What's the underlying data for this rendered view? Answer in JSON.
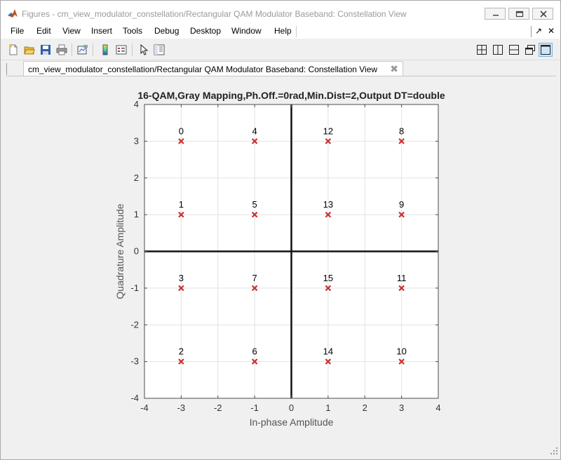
{
  "window": {
    "title": "Figures - cm_view_modulator_constellation/Rectangular QAM Modulator Baseband: Constellation View",
    "controls": [
      "minimize-icon",
      "maximize-icon",
      "close-icon"
    ]
  },
  "menu": {
    "items": [
      "File",
      "Edit",
      "View",
      "Insert",
      "Tools",
      "Debug",
      "Desktop",
      "Window",
      "Help"
    ],
    "right_arrow": "↗",
    "right_close": "✕"
  },
  "toolbar": {
    "left_icons": [
      "new-figure-icon",
      "open-file-icon",
      "save-icon",
      "print-icon",
      "link-plot-icon",
      "insert-colorbar-icon",
      "insert-legend-icon",
      "pointer-icon",
      "property-inspector-icon"
    ],
    "right_icons": [
      "tile-grid-icon",
      "tile-columns-icon",
      "tile-rows-icon",
      "float-icon",
      "maximize-figure-icon"
    ]
  },
  "tab": {
    "label": "cm_view_modulator_constellation/Rectangular QAM Modulator Baseband: Constellation View",
    "close": "✖"
  },
  "chart_data": {
    "type": "scatter",
    "title": "16-QAM,Gray Mapping,Ph.Off.=0rad,Min.Dist=2,Output DT=double",
    "xlabel": "In-phase Amplitude",
    "ylabel": "Quadrature Amplitude",
    "xlim": [
      -4,
      4
    ],
    "ylim": [
      -4,
      4
    ],
    "xticks": [
      -4,
      -3,
      -2,
      -1,
      0,
      1,
      2,
      3,
      4
    ],
    "yticks": [
      -4,
      -3,
      -2,
      -1,
      0,
      1,
      2,
      3,
      4
    ],
    "grid": true,
    "marker": "x",
    "marker_color": "#c83232",
    "points": [
      {
        "x": -3,
        "y": 3,
        "label": "0"
      },
      {
        "x": -1,
        "y": 3,
        "label": "4"
      },
      {
        "x": 1,
        "y": 3,
        "label": "12"
      },
      {
        "x": 3,
        "y": 3,
        "label": "8"
      },
      {
        "x": -3,
        "y": 1,
        "label": "1"
      },
      {
        "x": -1,
        "y": 1,
        "label": "5"
      },
      {
        "x": 1,
        "y": 1,
        "label": "13"
      },
      {
        "x": 3,
        "y": 1,
        "label": "9"
      },
      {
        "x": -3,
        "y": -1,
        "label": "3"
      },
      {
        "x": -1,
        "y": -1,
        "label": "7"
      },
      {
        "x": 1,
        "y": -1,
        "label": "15"
      },
      {
        "x": 3,
        "y": -1,
        "label": "11"
      },
      {
        "x": -3,
        "y": -3,
        "label": "2"
      },
      {
        "x": -1,
        "y": -3,
        "label": "6"
      },
      {
        "x": 1,
        "y": -3,
        "label": "14"
      },
      {
        "x": 3,
        "y": -3,
        "label": "10"
      }
    ]
  }
}
